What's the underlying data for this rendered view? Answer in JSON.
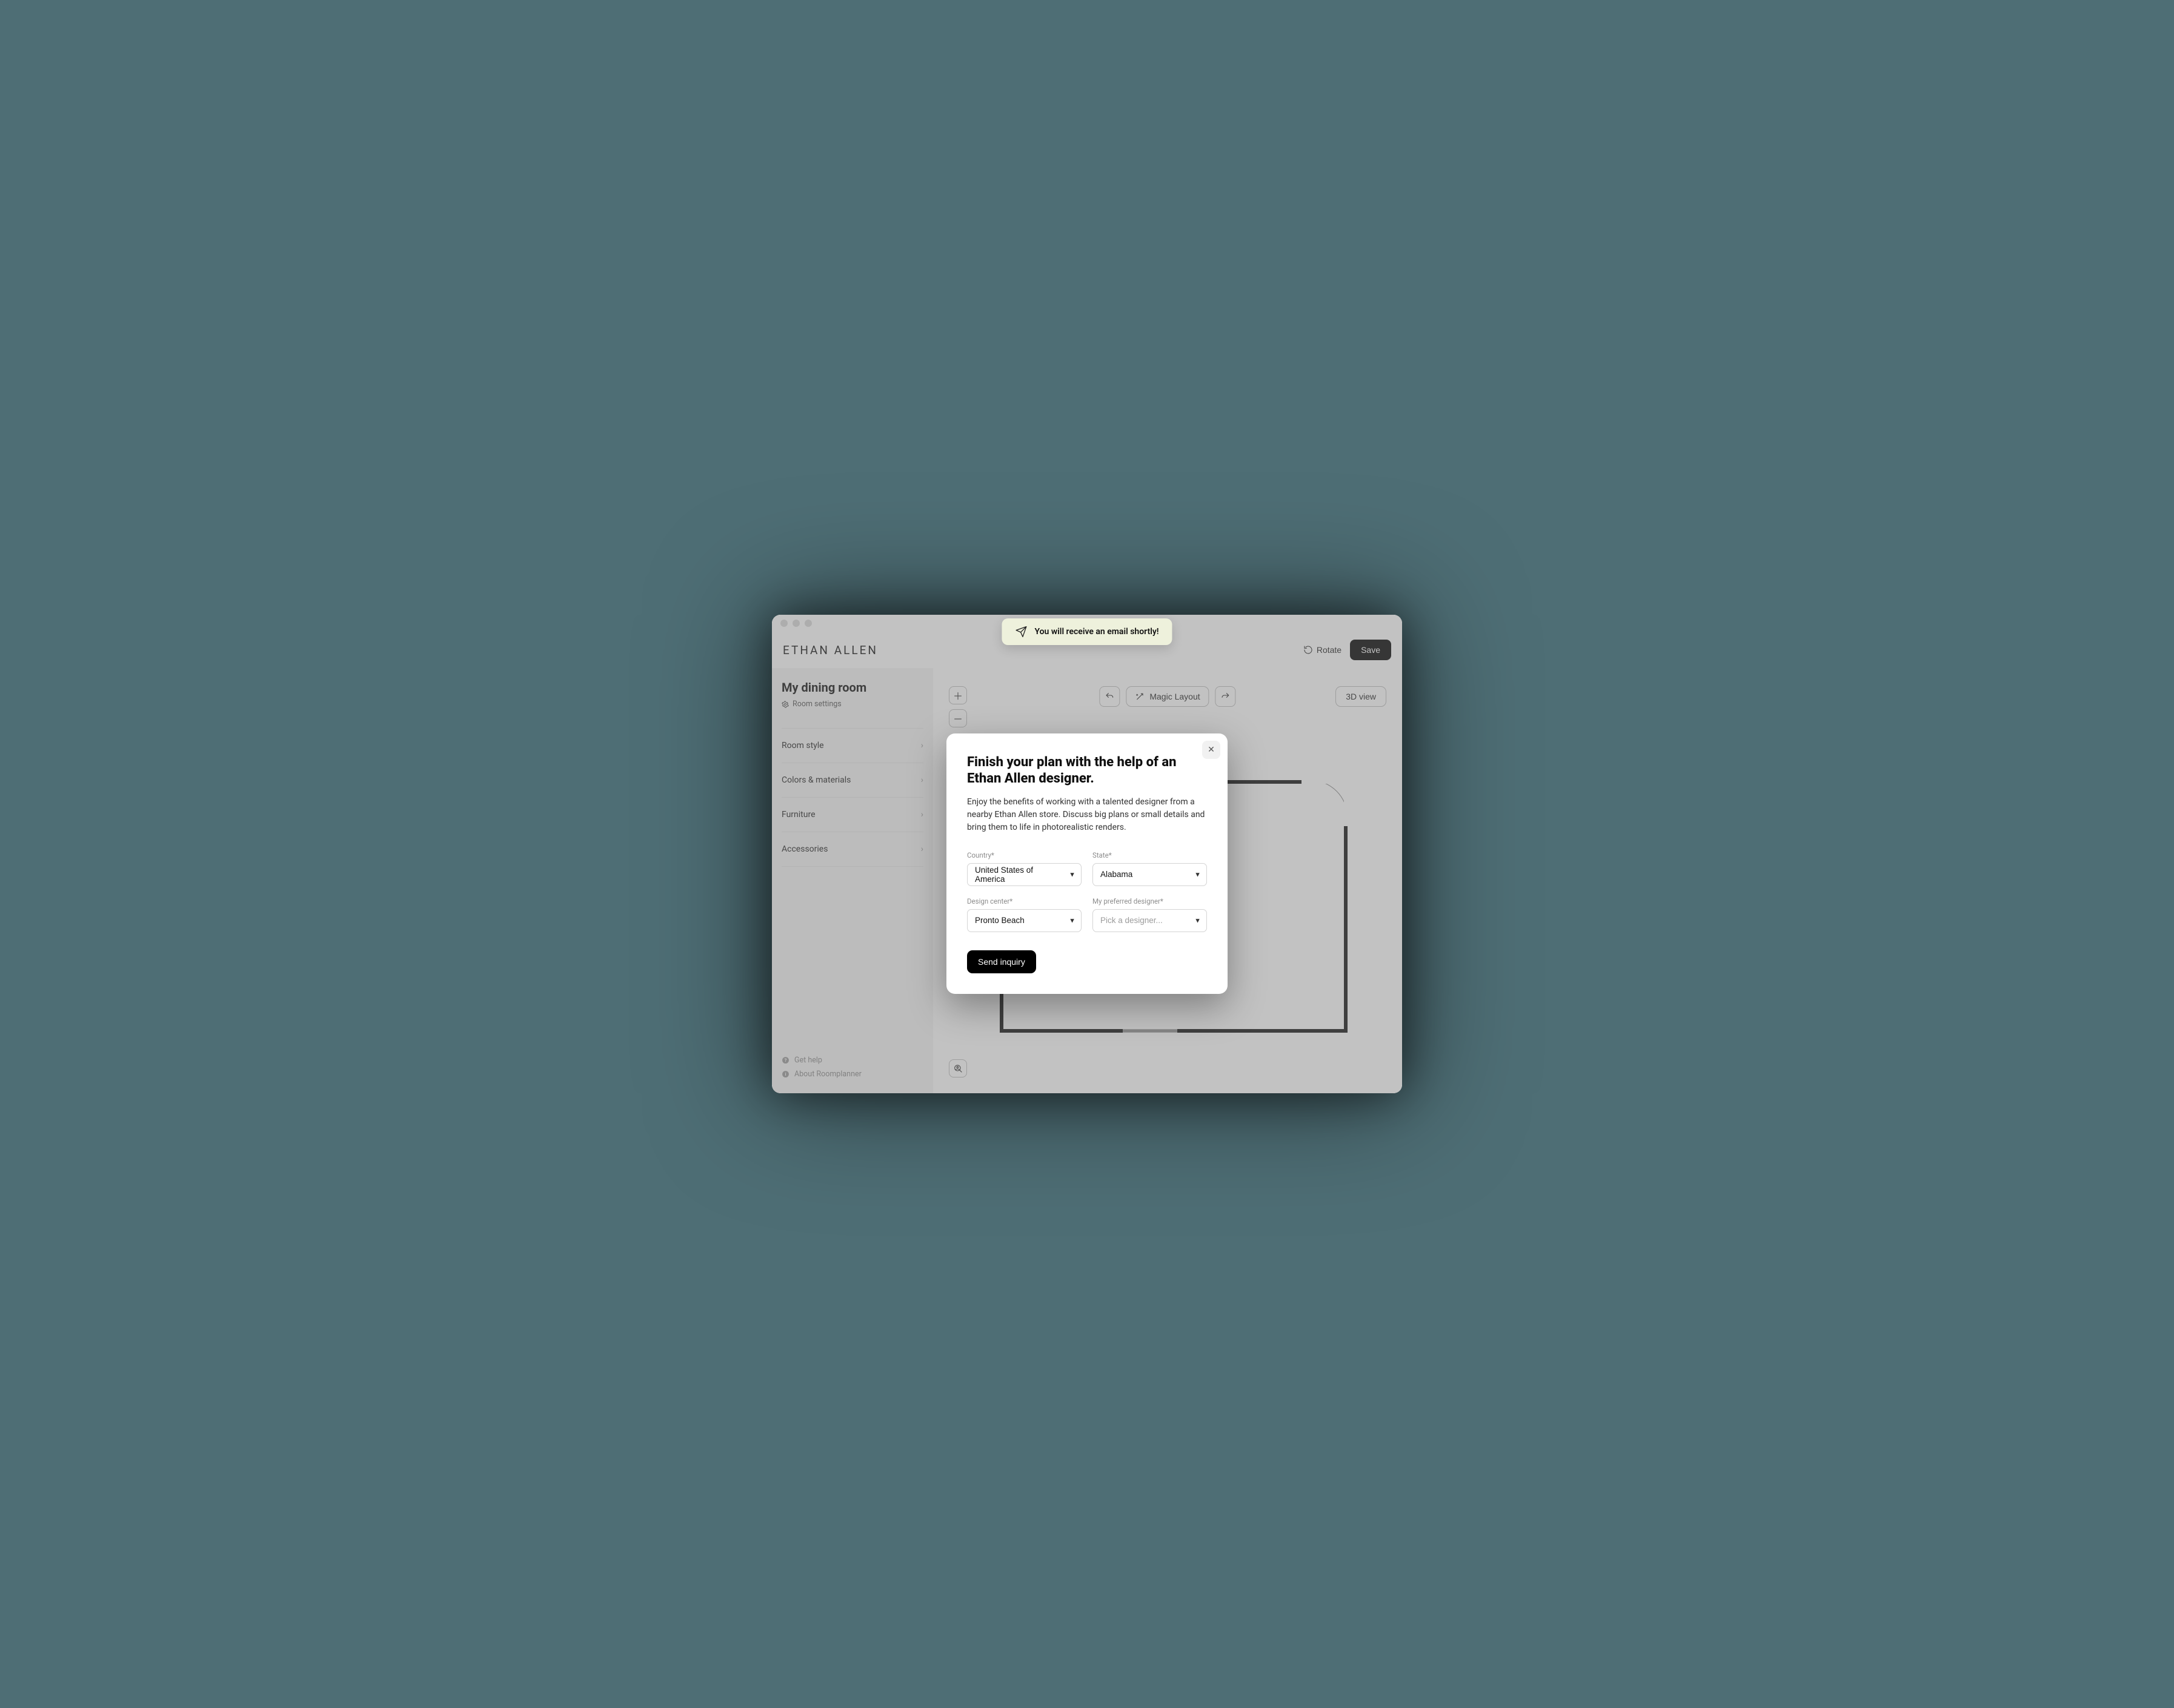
{
  "brand": "ETHAN ALLEN",
  "header": {
    "rotate": "Rotate",
    "save": "Save"
  },
  "toast": "You will receive an email shortly!",
  "sidebar": {
    "title": "My dining room",
    "settings": "Room settings",
    "items": [
      "Room style",
      "Colors & materials",
      "Furniture",
      "Accessories"
    ],
    "help": "Get help",
    "about": "About Roomplanner"
  },
  "toolbar": {
    "magic": "Magic Layout",
    "view3d": "3D view"
  },
  "modal": {
    "title": "Finish your plan with the help of an Ethan Allen designer.",
    "body": "Enjoy the benefits of working with a talented designer from a nearby Ethan Allen store. Discuss big plans or small details and bring them to life in photorealistic renders.",
    "fields": {
      "country_label": "Country*",
      "country_value": "United States of America",
      "state_label": "State*",
      "state_value": "Alabama",
      "center_label": "Design center*",
      "center_value": "Pronto Beach",
      "designer_label": "My preferred designer*",
      "designer_placeholder": "Pick a designer..."
    },
    "submit": "Send inquiry"
  }
}
